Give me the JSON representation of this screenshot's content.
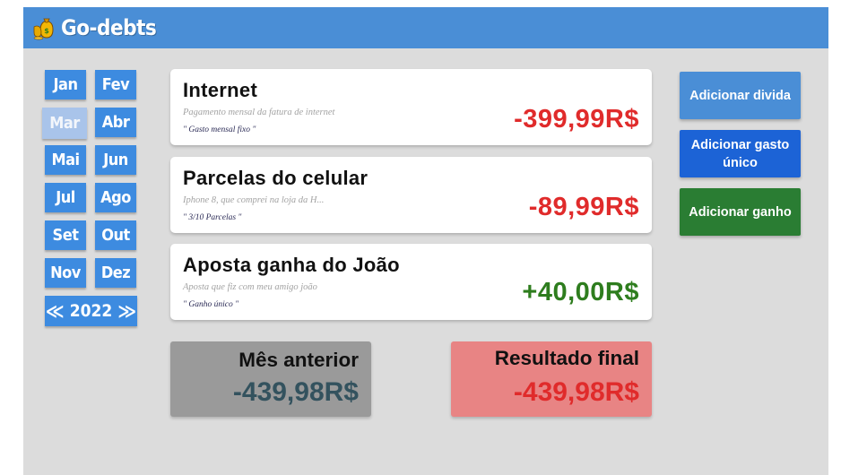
{
  "app": {
    "title": "Go-debts"
  },
  "calendar": {
    "months": [
      "Jan",
      "Fev",
      "Mar",
      "Abr",
      "Mai",
      "Jun",
      "Jul",
      "Ago",
      "Set",
      "Out",
      "Nov",
      "Dez"
    ],
    "selected_month": "Mar",
    "year": "2022",
    "prev_symbol": "≪",
    "next_symbol": "≫"
  },
  "entries": [
    {
      "title": "Internet",
      "description": "Pagamento mensal da fatura de internet",
      "tag": "\" Gasto mensal fixo \"",
      "amount": "-399,99R$",
      "kind": "negative"
    },
    {
      "title": "Parcelas do celular",
      "description": "Iphone 8, que comprei na loja da H...",
      "tag": "\" 3/10 Parcelas \"",
      "amount": "-89,99R$",
      "kind": "negative"
    },
    {
      "title": "Aposta ganha do João",
      "description": "Aposta que fiz com meu amigo joão",
      "tag": "\" Ganho único \"",
      "amount": "+40,00R$",
      "kind": "positive"
    }
  ],
  "actions": {
    "add_debt": "Adicionar divida",
    "add_single_expense": "Adicionar gasto único",
    "add_income": "Adicionar ganho"
  },
  "summary": {
    "previous_month_label": "Mês anterior",
    "previous_month_value": "-439,98R$",
    "final_result_label": "Resultado final",
    "final_result_value": "-439,98R$"
  },
  "colors": {
    "header": "#4a8ed6",
    "month_button": "#3d8be0",
    "month_selected": "#a9c4ea",
    "negative": "#e02b2b",
    "positive": "#2e7d1e",
    "add_debt": "#4a8ed6",
    "add_single_expense": "#1c63d6",
    "add_income": "#2a7d33",
    "previous_month_bg": "#9a9a9a",
    "previous_month_value": "#33525e",
    "final_result_bg": "#e88484"
  },
  "icons": {
    "logo": "money-bags-icon"
  }
}
